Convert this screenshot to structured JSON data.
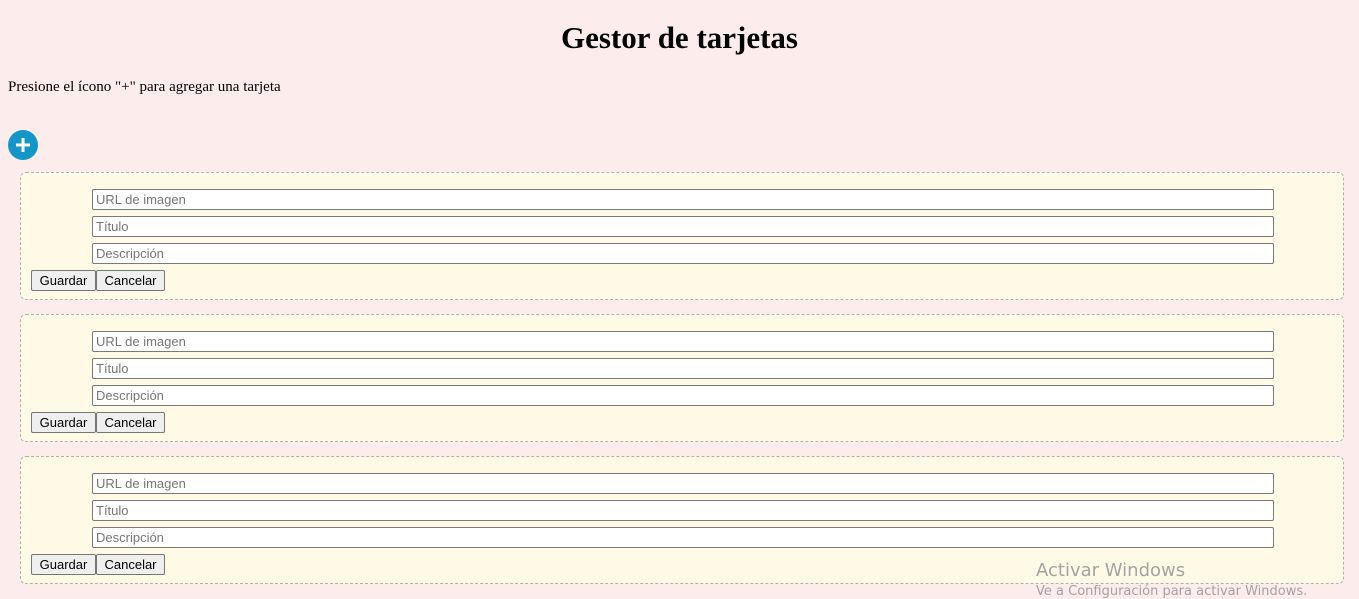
{
  "header": {
    "title": "Gestor de tarjetas",
    "instructions": "Presione el ícono \"+\" para agregar una tarjeta"
  },
  "add_button": {
    "icon": "plus-icon",
    "color": "#1596c8"
  },
  "forms": [
    {
      "url_placeholder": "URL de imagen",
      "title_placeholder": "Título",
      "description_placeholder": "Descripción",
      "save_label": "Guardar",
      "cancel_label": "Cancelar"
    },
    {
      "url_placeholder": "URL de imagen",
      "title_placeholder": "Título",
      "description_placeholder": "Descripción",
      "save_label": "Guardar",
      "cancel_label": "Cancelar"
    },
    {
      "url_placeholder": "URL de imagen",
      "title_placeholder": "Título",
      "description_placeholder": "Descripción",
      "save_label": "Guardar",
      "cancel_label": "Cancelar"
    }
  ],
  "colors": {
    "page_background": "#fdecec",
    "card_background": "#fefae6"
  },
  "watermark": {
    "title": "Activar Windows",
    "subtitle": "Ve a Configuración para activar Windows."
  }
}
